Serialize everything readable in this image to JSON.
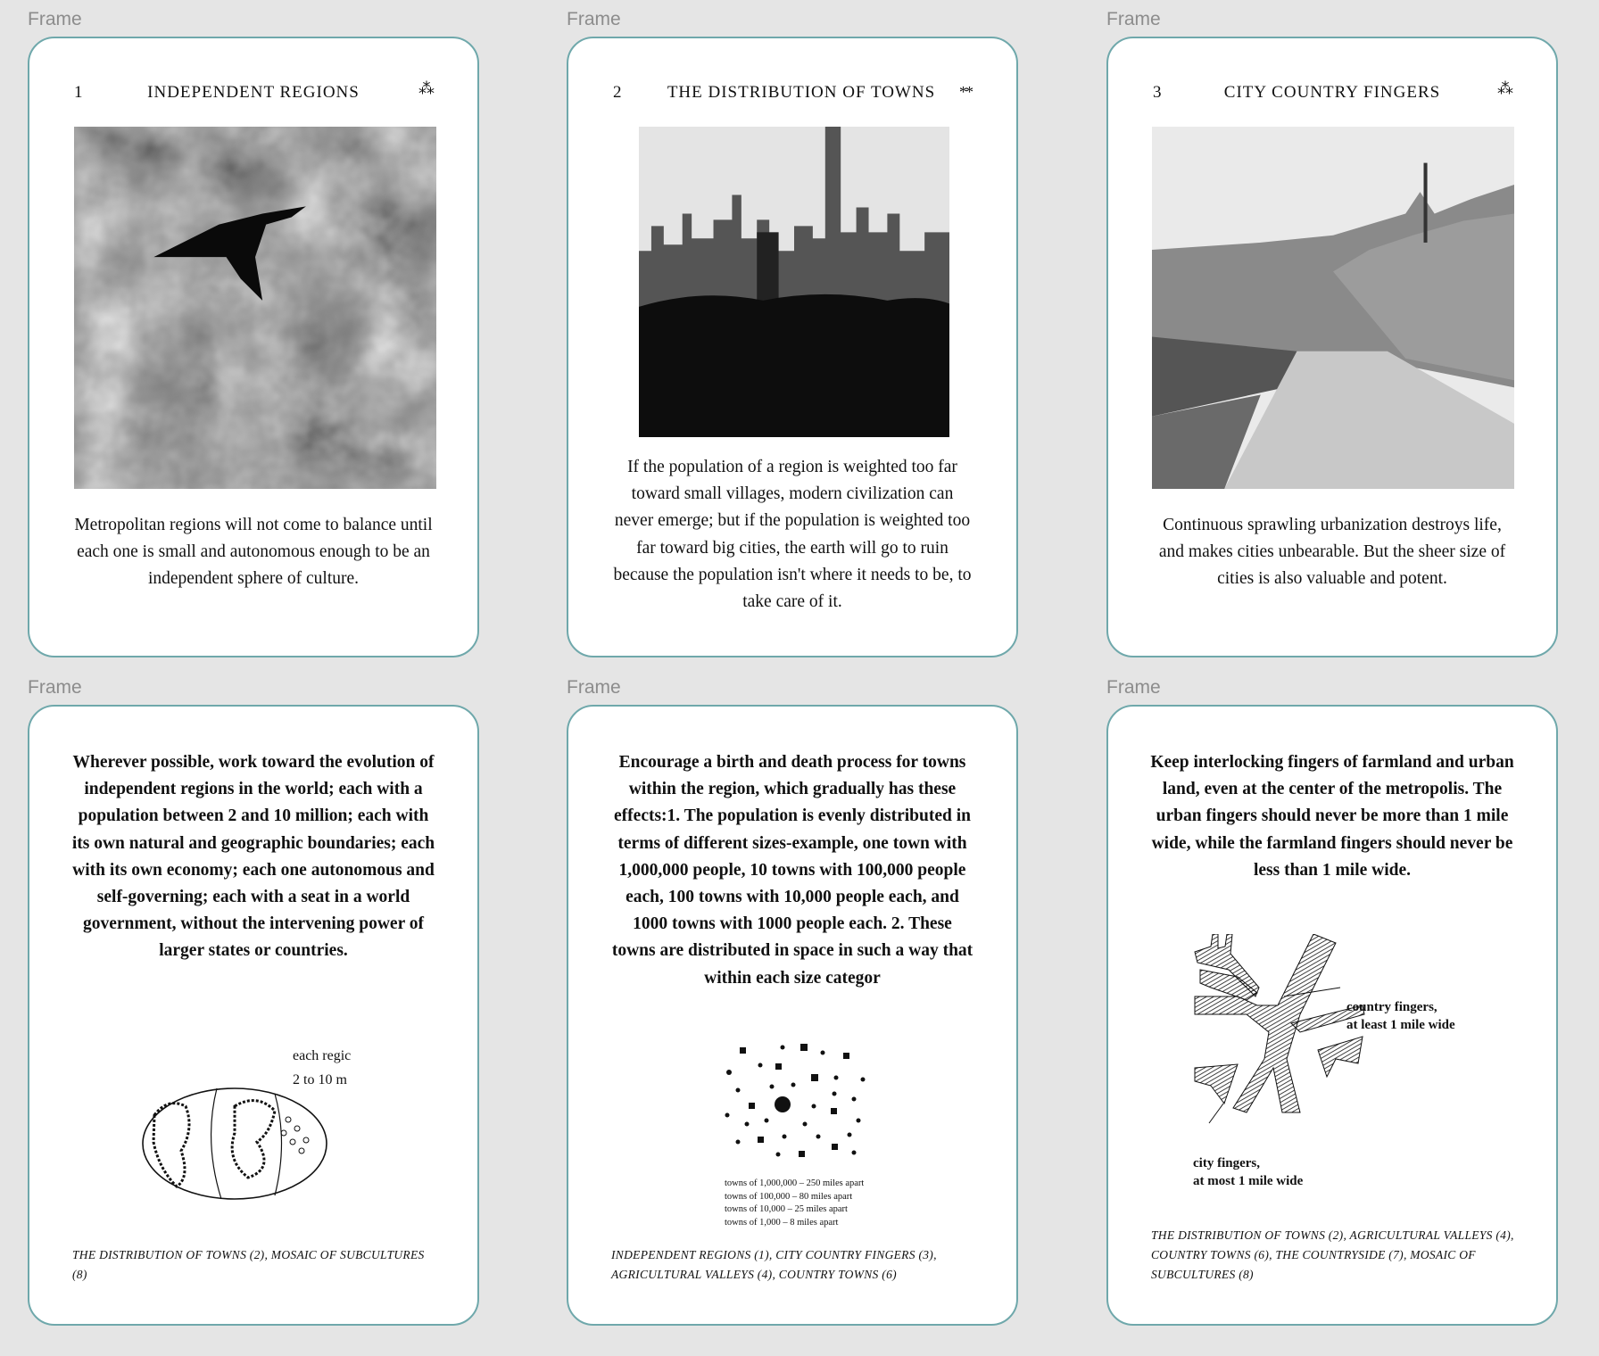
{
  "frame_label": "Frame",
  "cards": [
    {
      "number": "1",
      "title": "INDEPENDENT REGIONS",
      "stars": "⁂",
      "text": "Metropolitan regions will not come to balance until each one is small and autonomous enough to be an independent sphere of culture.",
      "back_text": "Wherever possible, work toward the evolution of independent regions in the world; each with a population between 2 and 10 million; each with its own natural and geographic boundaries; each with its own economy; each one autonomous and self-governing; each with a seat in a world government, without the intervening power of larger states or countries.",
      "figure_labels": [
        "each regic",
        "2 to 10 m"
      ],
      "related": "THE DISTRIBUTION OF TOWNS (2), MOSAIC OF SUBCULTURES (8)"
    },
    {
      "number": "2",
      "title": "THE DISTRIBUTION OF TOWNS",
      "stars": "**",
      "text": "If the population of a region is weighted too far toward small villages, modern civilization can never emerge; but if the population is weighted too far toward big cities, the earth will go to ruin because the population isn't where it needs to be, to take care of it.",
      "back_text": "Encourage a birth and death process for towns within the region, which gradually has these effects:1. The population is evenly distributed in terms of different sizes-example, one town with 1,000,000 people, 10 towns with 100,000 people each, 100 towns with 10,000 people each, and 1000 towns with 1000 people each. 2. These towns are distributed in space in such a way that within each size categor",
      "figure_labels": [
        "towns of 1,000,000 – 250 miles apart",
        "towns of 100,000 – 80 miles apart",
        "towns of 10,000 – 25 miles apart",
        "towns of 1,000 – 8 miles apart"
      ],
      "related": "INDEPENDENT REGIONS (1), CITY COUNTRY FINGERS (3), AGRICULTURAL VALLEYS (4), COUNTRY TOWNS (6)"
    },
    {
      "number": "3",
      "title": "CITY COUNTRY FINGERS",
      "stars": "⁂",
      "text": "Continuous sprawling urbanization destroys life, and makes cities unbearable. But the sheer size of cities is also valuable and potent.",
      "back_text": "Keep interlocking fingers of farmland and urban land, even at the center of the metropolis. The urban fingers should never be more than 1 mile wide, while the farmland fingers should never be less than 1 mile wide.",
      "figure_labels": [
        "country fingers,",
        "at least 1 mile wide",
        "city fingers,",
        "at most 1 mile wide"
      ],
      "related": "THE DISTRIBUTION OF TOWNS (2), AGRICULTURAL VALLEYS (4), COUNTRY TOWNS (6), THE COUNTRYSIDE (7), MOSAIC OF SUBCULTURES (8)"
    }
  ]
}
